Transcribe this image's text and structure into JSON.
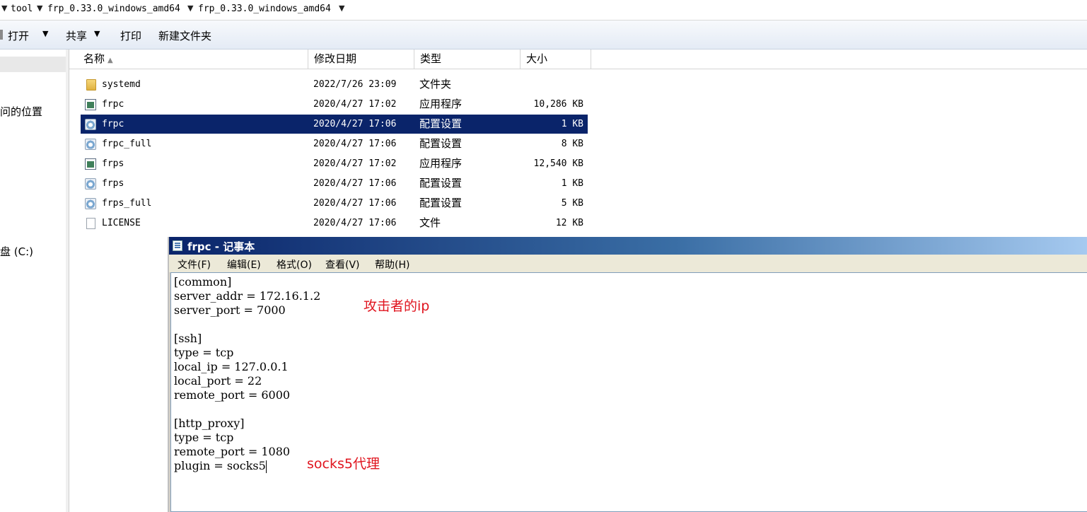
{
  "address_bar": {
    "crumbs": [
      "tool",
      "frp_0.33.0_windows_amd64",
      "frp_0.33.0_windows_amd64"
    ]
  },
  "toolbar": {
    "open": "打开",
    "share": "共享",
    "print": "打印",
    "new_folder": "新建文件夹"
  },
  "nav": {
    "recent_places_fragment": "问的位置",
    "drive_c_fragment": "盘 (C:)"
  },
  "columns": {
    "name": "名称",
    "date": "修改日期",
    "type": "类型",
    "size": "大小"
  },
  "files": [
    {
      "name": "systemd",
      "date": "2022/7/26 23:09",
      "type": "文件夹",
      "size": "",
      "icon": "folder-icon",
      "selected": false
    },
    {
      "name": "frpc",
      "date": "2020/4/27 17:02",
      "type": "应用程序",
      "size": "10,286 KB",
      "icon": "app-icon",
      "selected": false
    },
    {
      "name": "frpc",
      "date": "2020/4/27 17:06",
      "type": "配置设置",
      "size": "1 KB",
      "icon": "config-file-icon",
      "selected": true
    },
    {
      "name": "frpc_full",
      "date": "2020/4/27 17:06",
      "type": "配置设置",
      "size": "8 KB",
      "icon": "config-file-icon",
      "selected": false
    },
    {
      "name": "frps",
      "date": "2020/4/27 17:02",
      "type": "应用程序",
      "size": "12,540 KB",
      "icon": "app-icon",
      "selected": false
    },
    {
      "name": "frps",
      "date": "2020/4/27 17:06",
      "type": "配置设置",
      "size": "1 KB",
      "icon": "config-file-icon",
      "selected": false
    },
    {
      "name": "frps_full",
      "date": "2020/4/27 17:06",
      "type": "配置设置",
      "size": "5 KB",
      "icon": "config-file-icon",
      "selected": false
    },
    {
      "name": "LICENSE",
      "date": "2020/4/27 17:06",
      "type": "文件",
      "size": "12 KB",
      "icon": "file-icon",
      "selected": false
    }
  ],
  "notepad": {
    "title": "frpc - 记事本",
    "menu": [
      "文件(F)",
      "编辑(E)",
      "格式(O)",
      "查看(V)",
      "帮助(H)"
    ],
    "lines": [
      "[common]",
      "server_addr = 172.16.1.2",
      "server_port = 7000",
      "",
      "[ssh]",
      "type = tcp",
      "local_ip = 127.0.0.1",
      "local_port = 22",
      "remote_port = 6000",
      "",
      "[http_proxy]",
      "type = tcp",
      "remote_port = 1080",
      "plugin = socks5"
    ]
  },
  "annotations": {
    "attacker_ip": "攻击者的ip",
    "socks5_proxy": "socks5代理",
    "color": "#e0141e"
  },
  "colors": {
    "selection": "#0a246a",
    "title_bar_start": "#0a246a",
    "title_bar_end": "#a6caf0"
  }
}
